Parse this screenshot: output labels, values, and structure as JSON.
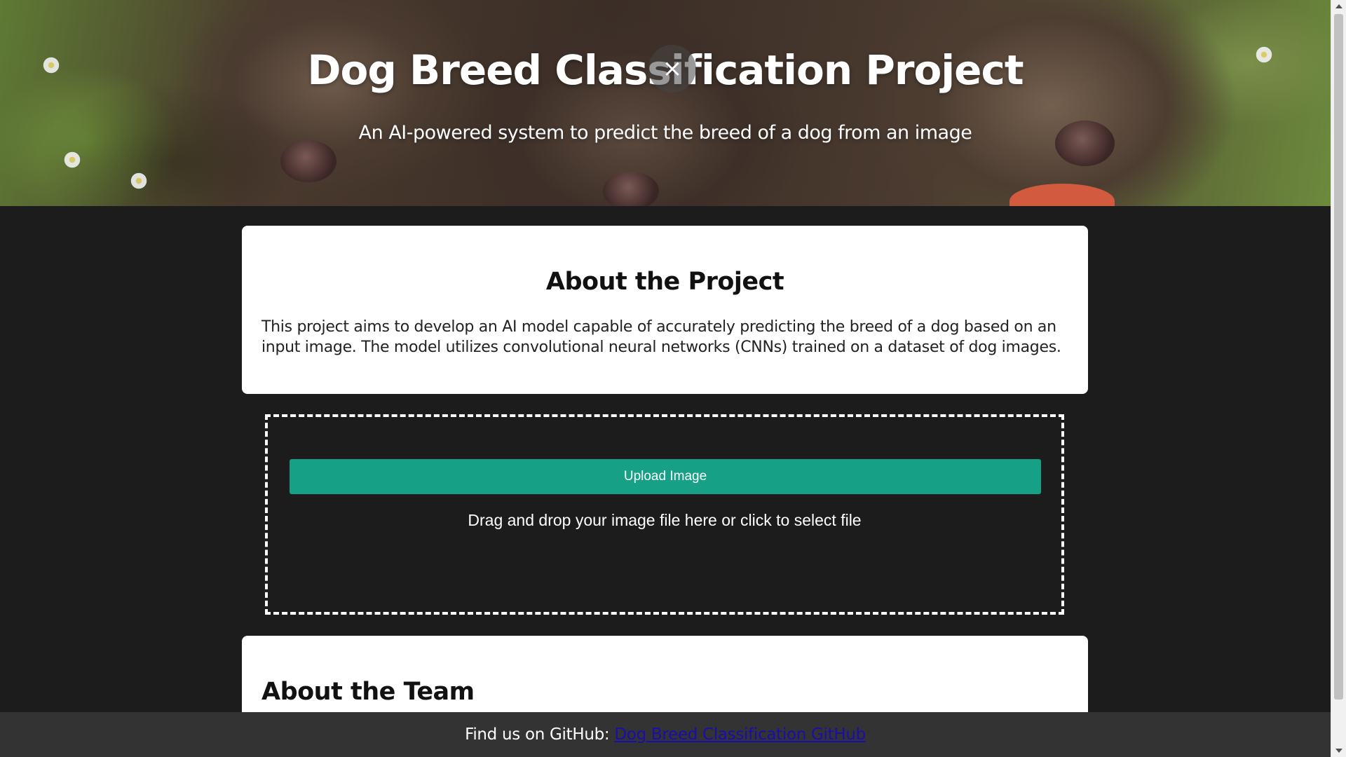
{
  "hero": {
    "title": "Dog Breed Classification Project",
    "subtitle": "An AI-powered system to predict the breed of a dog from an image",
    "close_glyph": "×"
  },
  "about_project": {
    "heading": "About the Project",
    "body": "This project aims to develop an AI model capable of accurately predicting the breed of a dog based on an input image. The model utilizes convolutional neural networks (CNNs) trained on a dataset of dog images."
  },
  "upload": {
    "button_label": "Upload Image",
    "drop_text": "Drag and drop your image file here or click to select file"
  },
  "about_team": {
    "heading": "About the Team"
  },
  "footer": {
    "prefix": "Find us on GitHub:",
    "link_text": "Dog Breed Classification GitHub"
  },
  "colors": {
    "page_background": "#1c1c1c",
    "card_background": "#ffffff",
    "accent_button": "#16a085",
    "footer_background": "#333333",
    "link": "#1a0dab"
  },
  "icons": {
    "close": "close-icon",
    "hero_image": "puppies-photo"
  }
}
